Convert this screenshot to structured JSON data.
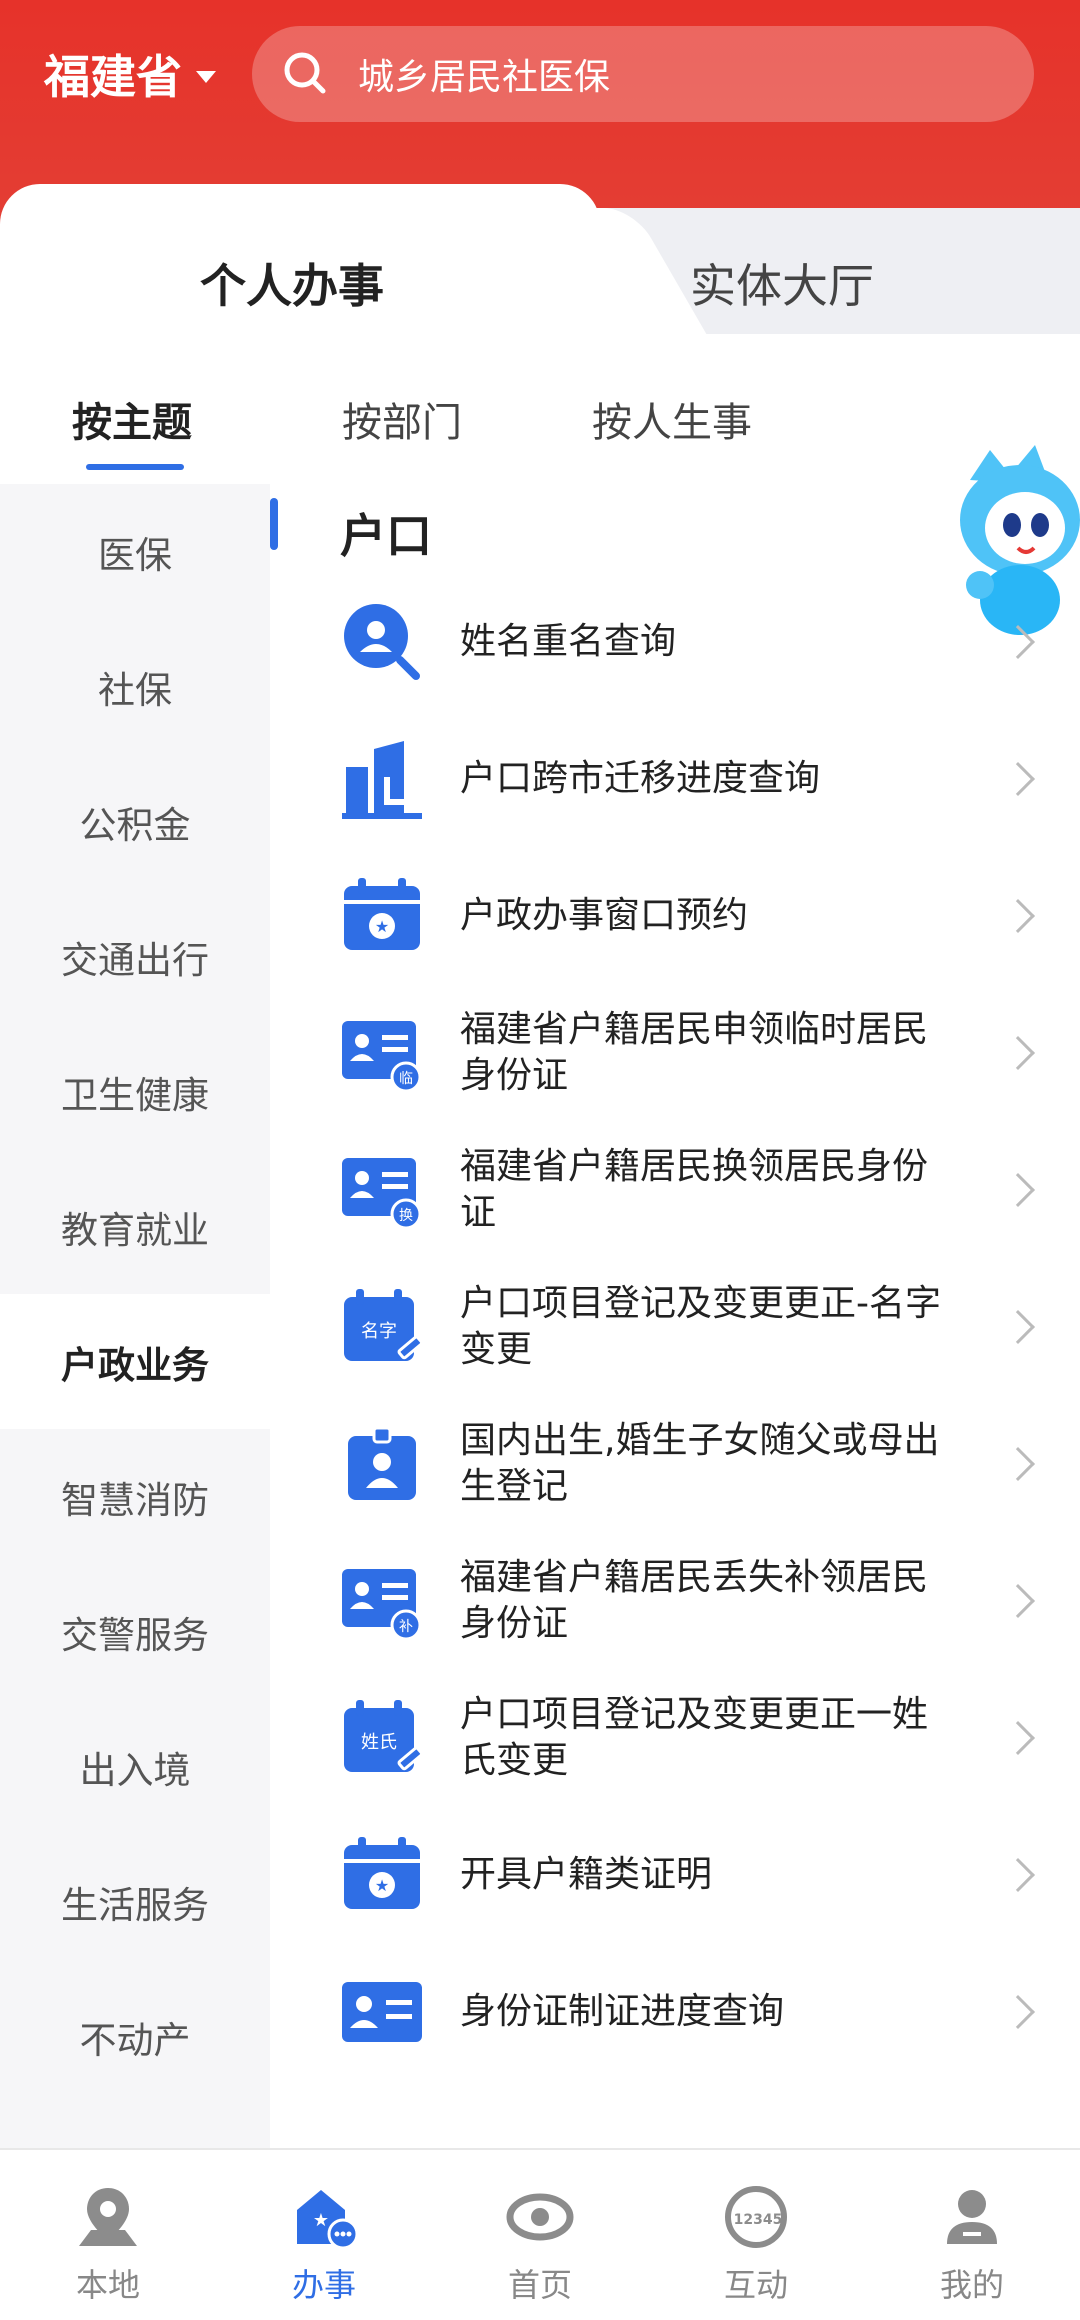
{
  "header": {
    "province": "福建省",
    "search_placeholder": "城乡居民社医保"
  },
  "top_tabs": {
    "active": "个人办事",
    "other": "实体大厅"
  },
  "sub_tabs": [
    "按主题",
    "按部门",
    "按人生事"
  ],
  "sidebar": {
    "items": [
      {
        "label": "医保"
      },
      {
        "label": "社保"
      },
      {
        "label": "公积金"
      },
      {
        "label": "交通出行"
      },
      {
        "label": "卫生健康"
      },
      {
        "label": "教育就业"
      },
      {
        "label": "户政业务",
        "active": true
      },
      {
        "label": "智慧消防"
      },
      {
        "label": "交警服务"
      },
      {
        "label": "出入境"
      },
      {
        "label": "生活服务"
      },
      {
        "label": "不动产"
      }
    ]
  },
  "content": {
    "section_title": "户口",
    "items": [
      {
        "label": "姓名重名查询",
        "icon": "search-person-icon"
      },
      {
        "label": "户口跨市迁移进度查询",
        "icon": "building-icon"
      },
      {
        "label": "户政办事窗口预约",
        "icon": "calendar-star-icon"
      },
      {
        "label": "福建省户籍居民申领临时居民身份证",
        "icon": "id-card-temp-icon"
      },
      {
        "label": "福建省户籍居民换领居民身份证",
        "icon": "id-card-exchange-icon"
      },
      {
        "label": "户口项目登记及变更更正-名字变更",
        "icon": "name-edit-icon"
      },
      {
        "label": "国内出生,婚生子女随父或母出生登记",
        "icon": "badge-person-icon"
      },
      {
        "label": "福建省户籍居民丢失补领居民身份证",
        "icon": "id-card-replace-icon"
      },
      {
        "label": "户口项目登记及变更更正一姓氏变更",
        "icon": "surname-edit-icon"
      },
      {
        "label": "开具户籍类证明",
        "icon": "calendar-star-icon"
      },
      {
        "label": "身份证制证进度查询",
        "icon": "id-card-icon"
      }
    ],
    "icon_badges": {
      "temp": "临",
      "exchange": "换",
      "replace": "补",
      "name": "名字",
      "surname": "姓氏"
    }
  },
  "bottom_nav": {
    "items": [
      {
        "label": "本地",
        "icon": "location-icon"
      },
      {
        "label": "办事",
        "icon": "service-icon",
        "active": true
      },
      {
        "label": "首页",
        "icon": "home-eye-icon"
      },
      {
        "label": "互动",
        "icon": "hotline-12345-icon"
      },
      {
        "label": "我的",
        "icon": "profile-icon"
      }
    ],
    "hotline_number": "12345"
  },
  "colors": {
    "header_red": "#e6322a",
    "accent_blue": "#2f6ee5",
    "sidebar_bg": "#f6f6f8"
  }
}
